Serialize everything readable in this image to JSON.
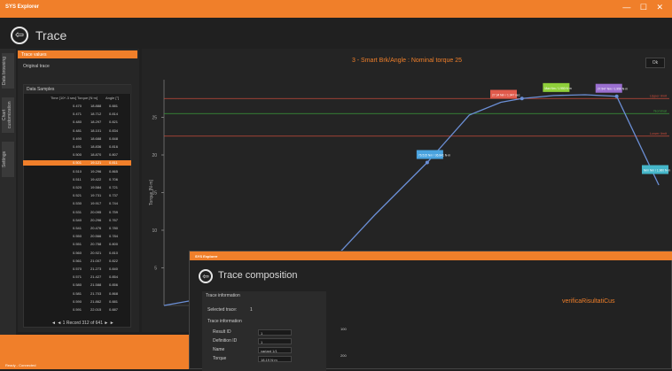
{
  "titlebar": {
    "title": "SYS Explorer",
    "controls": "— ☐ ✕"
  },
  "page": {
    "title": "Trace"
  },
  "sidebar": {
    "tabs": [
      "Data browsing",
      "Chart customization",
      "Settings"
    ]
  },
  "panel": {
    "header": "Trace values",
    "original_trace": "Original trace",
    "samples_title": "Data Samples",
    "columns": [
      "Time [10^-3 sec]",
      "Torque [N·m]",
      "Angle [°]"
    ],
    "rows": [
      [
        "0.470",
        "18.888",
        "0.881"
      ],
      [
        "0.471",
        "18.712",
        "0.814"
      ],
      [
        "0.480",
        "18.297",
        "0.821"
      ],
      [
        "0.481",
        "18.101",
        "0.834"
      ],
      [
        "0.490",
        "18.688",
        "0.848"
      ],
      [
        "0.491",
        "18.836",
        "0.816"
      ],
      [
        "0.500",
        "18.870",
        "0.807"
      ],
      [
        "0.501",
        "19.121",
        "0.811"
      ],
      [
        "0.510",
        "19.296",
        "0.865"
      ],
      [
        "0.511",
        "19.422",
        "0.706"
      ],
      [
        "0.520",
        "19.584",
        "0.721"
      ],
      [
        "0.521",
        "19.731",
        "0.737"
      ],
      [
        "0.530",
        "19.917",
        "0.744"
      ],
      [
        "0.531",
        "20.095",
        "0.759"
      ],
      [
        "0.540",
        "20.296",
        "0.767"
      ],
      [
        "0.541",
        "20.476",
        "0.780"
      ],
      [
        "0.550",
        "20.566",
        "0.784"
      ],
      [
        "0.551",
        "20.758",
        "0.800"
      ],
      [
        "0.560",
        "20.921",
        "0.810"
      ],
      [
        "0.561",
        "21.007",
        "0.822"
      ],
      [
        "0.570",
        "21.273",
        "0.840"
      ],
      [
        "0.571",
        "21.427",
        "0.854"
      ],
      [
        "0.580",
        "21.588",
        "0.856"
      ],
      [
        "0.581",
        "21.703",
        "0.868"
      ],
      [
        "0.590",
        "21.862",
        "0.881"
      ],
      [
        "0.591",
        "22.015",
        "0.887"
      ]
    ],
    "selected_row_index": 7,
    "footer": "◄ ◄ 1 Record 312 of 641 ► ►"
  },
  "chart": {
    "title": "3 - Smart Brk/Angle : Nominal torque 25",
    "tab": "Ok",
    "ylabel": "Torque [N·m]",
    "limit_labels": [
      "Upper limit",
      "Nominal",
      "Lower limit"
    ]
  },
  "chart_data": {
    "type": "line",
    "title": "3 - Smart Brk/Angle : Nominal torque 25",
    "ylabel": "Torque [N·m]",
    "xlabel": "",
    "ylim": [
      0,
      30
    ],
    "yticks": [
      5,
      10,
      15,
      20,
      25
    ],
    "series": [
      {
        "x": [
          0,
          40,
          80,
          100,
          125,
          145,
          160,
          170,
          185,
          200,
          215,
          235
        ],
        "values": [
          0,
          2,
          6,
          12,
          19,
          25.3,
          27,
          27.5,
          27.9,
          28,
          27.8,
          16
        ]
      }
    ],
    "reference_lines": [
      27.5,
      25.5,
      22.5
    ],
    "annotations": [
      {
        "text": "76.515 Nm / 36.841 N·m",
        "x": 125,
        "y": 19,
        "color": "#4aa3df"
      },
      {
        "text": "27.34 Nm / 1.947 sec",
        "x": 160,
        "y": 27,
        "color": "#e05a4b"
      },
      {
        "text": "Max Nm / 1.950 N·m",
        "x": 185,
        "y": 27.9,
        "color": "#8fcf3a"
      },
      {
        "text": "27.547 Nm / 1.950 N·m",
        "x": 210,
        "y": 27.8,
        "color": "#9a6fd0"
      },
      {
        "text": "Nm/ Nm / 1.960 N·m",
        "x": 232,
        "y": 17,
        "color": "#45b6c9"
      }
    ]
  },
  "bottom": {
    "status": "Ready - Connected"
  },
  "window2": {
    "titlebar": "SYS Explorer",
    "title": "Trace composition",
    "panel_header": "Trace information",
    "selected_trace_label": "Selected trace:",
    "selected_trace_value": "1",
    "section": "Trace information",
    "fields": [
      {
        "label": "Result ID",
        "value": "1"
      },
      {
        "label": "Definition ID",
        "value": "1"
      },
      {
        "label": "Name",
        "value": "variant 1/1"
      },
      {
        "label": "Torque",
        "value": "18.19 N·m"
      }
    ],
    "chart_title": "verificaRisultatiCus",
    "yticks": [
      "100",
      "200"
    ]
  }
}
